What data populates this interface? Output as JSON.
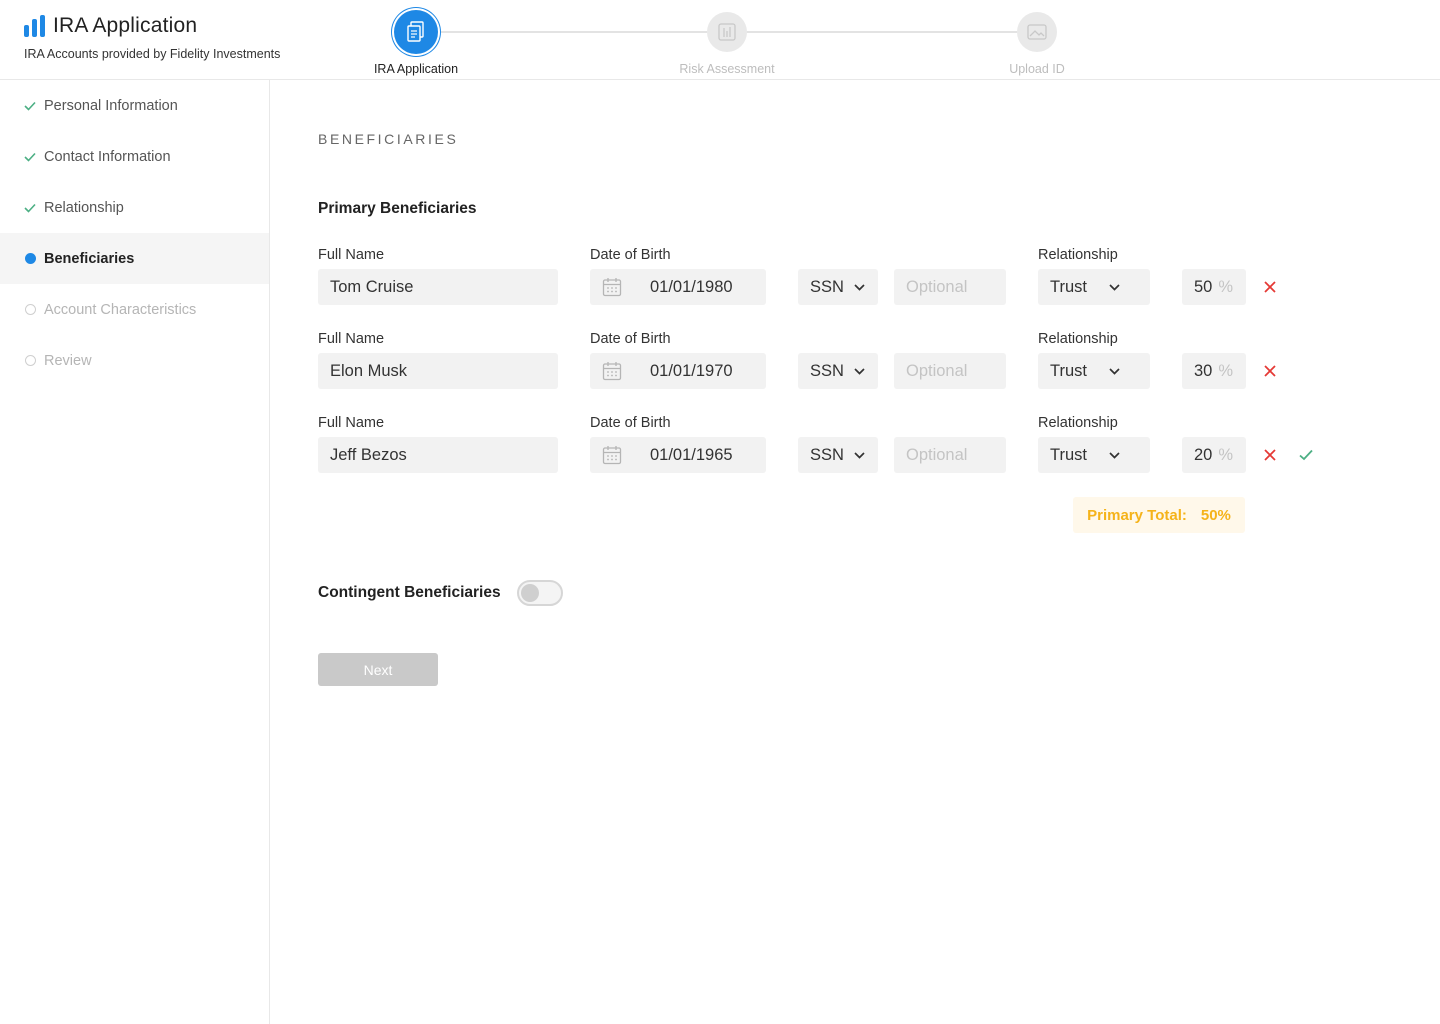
{
  "header": {
    "app_title": "IRA Application",
    "subtitle": "IRA Accounts provided by Fidelity Investments",
    "steps": [
      {
        "label": "IRA Application",
        "state": "active",
        "icon": "document-icon"
      },
      {
        "label": "Risk Assessment",
        "state": "inactive",
        "icon": "chart-icon"
      },
      {
        "label": "Upload ID",
        "state": "inactive",
        "icon": "image-icon"
      }
    ]
  },
  "sidebar": {
    "items": [
      {
        "label": "Personal Information",
        "state": "done"
      },
      {
        "label": "Contact Information",
        "state": "done"
      },
      {
        "label": "Relationship",
        "state": "done"
      },
      {
        "label": "Beneficiaries",
        "state": "current"
      },
      {
        "label": "Account Characteristics",
        "state": "todo"
      },
      {
        "label": "Review",
        "state": "todo"
      }
    ]
  },
  "main": {
    "section_title": "BENEFICIARIES",
    "primary_title": "Primary Beneficiaries",
    "labels": {
      "full_name": "Full Name",
      "dob": "Date of Birth",
      "relationship": "Relationship",
      "percent_sign": "%"
    },
    "beneficiaries": [
      {
        "name": "Tom Cruise",
        "dob": "01/01/1980",
        "id_type": "SSN",
        "id_placeholder": "Optional",
        "relationship": "Trust",
        "percent": "50"
      },
      {
        "name": "Elon Musk",
        "dob": "01/01/1970",
        "id_type": "SSN",
        "id_placeholder": "Optional",
        "relationship": "Trust",
        "percent": "30"
      },
      {
        "name": "Jeff Bezos",
        "dob": "01/01/1965",
        "id_type": "SSN",
        "id_placeholder": "Optional",
        "relationship": "Trust",
        "percent": "20"
      }
    ],
    "primary_total_label": "Primary Total:",
    "primary_total_value": "50%",
    "contingent_title": "Contingent Beneficiaries",
    "contingent_enabled": false,
    "next_label": "Next"
  },
  "colors": {
    "accent": "#1e88e5",
    "done_check": "#4caf84",
    "remove": "#e53935",
    "warning": "#f5b31a"
  }
}
